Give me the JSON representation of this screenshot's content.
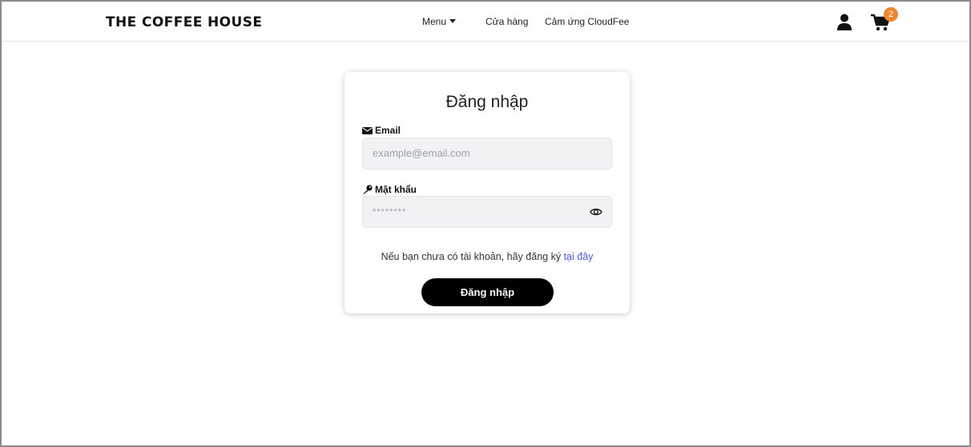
{
  "header": {
    "brand": "THE COFFEE HOUSE",
    "nav": {
      "menu": "Menu",
      "store": "Cửa hàng",
      "inspire": "Cảm ứng CloudFee"
    },
    "cart_count": "2"
  },
  "login_form": {
    "title": "Đăng nhập",
    "email_label": "Email",
    "email_placeholder": "example@email.com",
    "password_label": "Mật khẩu",
    "password_value": "********",
    "register_prompt": "Nếu bạn chưa có tài khoản, hãy đăng ký",
    "register_link": "tại đây",
    "submit_label": "Đăng nhập"
  },
  "colors": {
    "accent_link": "#4a5bd4",
    "badge": "#f0862d",
    "button": "#000000"
  },
  "icons": [
    "user-icon",
    "cart-icon",
    "envelope-icon",
    "key-icon",
    "eye-icon",
    "caret-down-icon"
  ]
}
